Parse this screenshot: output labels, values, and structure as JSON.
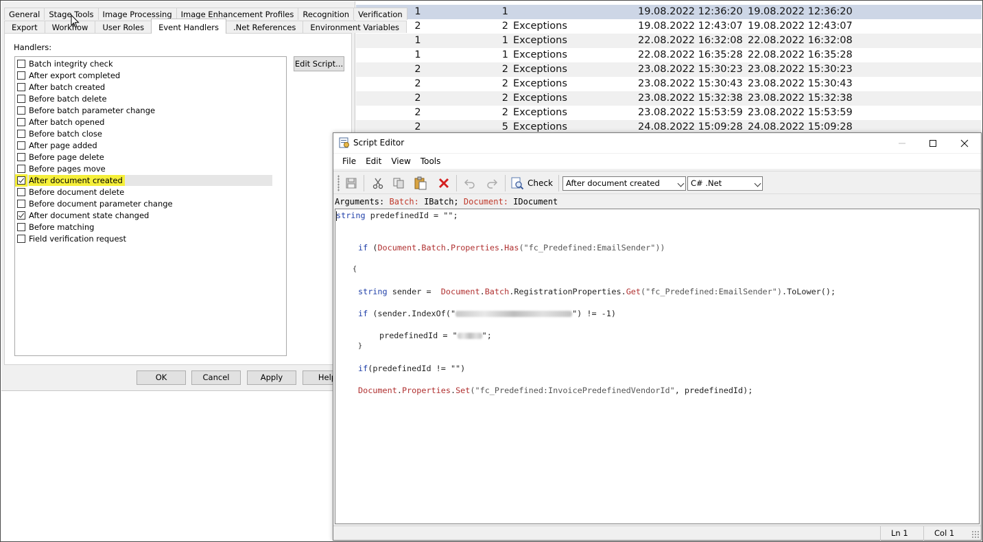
{
  "background_table": {
    "rows": [
      {
        "a": "1",
        "b": "1",
        "c": "",
        "d": "19.08.2022 12:36:20",
        "e": "19.08.2022 12:36:20"
      },
      {
        "a": "2",
        "b": "2",
        "c": "Exceptions",
        "d": "19.08.2022 12:43:07",
        "e": "19.08.2022 12:43:07"
      },
      {
        "a": "1",
        "b": "1",
        "c": "Exceptions",
        "d": "22.08.2022 16:32:08",
        "e": "22.08.2022 16:32:08"
      },
      {
        "a": "1",
        "b": "1",
        "c": "Exceptions",
        "d": "22.08.2022 16:35:28",
        "e": "22.08.2022 16:35:28"
      },
      {
        "a": "2",
        "b": "2",
        "c": "Exceptions",
        "d": "23.08.2022 15:30:23",
        "e": "23.08.2022 15:30:23"
      },
      {
        "a": "2",
        "b": "2",
        "c": "Exceptions",
        "d": "23.08.2022 15:30:43",
        "e": "23.08.2022 15:30:43"
      },
      {
        "a": "2",
        "b": "2",
        "c": "Exceptions",
        "d": "23.08.2022 15:32:38",
        "e": "23.08.2022 15:32:38"
      },
      {
        "a": "2",
        "b": "2",
        "c": "Exceptions",
        "d": "23.08.2022 15:53:59",
        "e": "23.08.2022 15:53:59"
      },
      {
        "a": "2",
        "b": "5",
        "c": "Exceptions",
        "d": "24.08.2022 15:09:28",
        "e": "24.08.2022 15:09:28"
      }
    ]
  },
  "dialog": {
    "tabs_row1": [
      "General",
      "Stage Tools",
      "Image Processing",
      "Image Enhancement Profiles",
      "Recognition",
      "Verification"
    ],
    "tabs_row2": [
      "Export",
      "Workflow",
      "User Roles",
      "Event Handlers",
      ".Net References",
      "Environment Variables"
    ],
    "active_tab": "Event Handlers",
    "handlers_label": "Handlers:",
    "edit_script_label": "Edit Script...",
    "handlers": [
      {
        "label": "Batch integrity check",
        "checked": false
      },
      {
        "label": "After export completed",
        "checked": false
      },
      {
        "label": "After batch created",
        "checked": false
      },
      {
        "label": "Before batch delete",
        "checked": false
      },
      {
        "label": "Before batch parameter change",
        "checked": false
      },
      {
        "label": "After batch opened",
        "checked": false
      },
      {
        "label": "Before batch close",
        "checked": false
      },
      {
        "label": "After page added",
        "checked": false
      },
      {
        "label": "Before page delete",
        "checked": false
      },
      {
        "label": "Before pages move",
        "checked": false
      },
      {
        "label": "After document created",
        "checked": true,
        "selected": true,
        "highlight_color": "#f5ef3a"
      },
      {
        "label": "Before document delete",
        "checked": false
      },
      {
        "label": "Before document parameter change",
        "checked": false
      },
      {
        "label": "After document state changed",
        "checked": true
      },
      {
        "label": "Before matching",
        "checked": false
      },
      {
        "label": "Field verification request",
        "checked": false
      }
    ],
    "buttons": {
      "ok": "OK",
      "cancel": "Cancel",
      "apply": "Apply",
      "help": "Help"
    }
  },
  "editor": {
    "title": "Script Editor",
    "menu": [
      "File",
      "Edit",
      "View",
      "Tools"
    ],
    "check_label": "Check",
    "event_combo": "After document created",
    "language_combo": "C# .Net",
    "arguments": {
      "prefix": "Arguments:",
      "arg1_name": "Batch:",
      "arg1_type": "IBatch;",
      "arg2_name": "Document:",
      "arg2_type": "IDocument"
    },
    "code": {
      "l1_kw": "string",
      "l1_rest": " predefinedId = \"\";",
      "l2_kw": "if",
      "l2_a": " (",
      "l2_obj": "Document",
      "l2_dot1": ".",
      "l2_batch": "Batch",
      "l2_dot2": ".",
      "l2_props": "Properties",
      "l2_dot3": ".",
      "l2_has": "Has",
      "l2_str": "(\"fc_Predefined:EmailSender\"))",
      "l3": "{",
      "l4_kw": "string",
      "l4_a": " sender =  ",
      "l4_obj": "Document",
      "l4_dot1": ".",
      "l4_batch": "Batch",
      "l4_b": ".RegistrationProperties.",
      "l4_get": "Get",
      "l4_str": "(\"fc_Predefined:EmailSender\")",
      "l4_c": ".ToLower();",
      "l5_kw": "if",
      "l5_a": " (sender.IndexOf(\"",
      "l5_b": "\") != -1)",
      "l6_a": "predefinedId = \"",
      "l6_b": "\";",
      "l7": "}",
      "l8_kw": "if",
      "l8_rest": "(predefinedId != \"\")",
      "l9_obj": "Document",
      "l9_dot1": ".",
      "l9_props": "Properties",
      "l9_dot2": ".",
      "l9_set": "Set",
      "l9_str": "(\"fc_Predefined:InvoicePredefinedVendorId\"",
      "l9_rest": ", predefinedId);"
    },
    "status": {
      "line": "Ln 1",
      "col": "Col 1"
    }
  },
  "colors": {
    "keyword_blue": "#1f3fa8",
    "member_red": "#b03030",
    "selection_row": "#cdd6e6",
    "highlight_yellow": "#f5ef3a"
  },
  "icons": [
    "save-icon",
    "cut-icon",
    "copy-icon",
    "paste-icon",
    "delete-icon",
    "undo-icon",
    "redo-icon",
    "check-icon",
    "minimize-icon",
    "maximize-icon",
    "close-icon",
    "script-editor-app-icon"
  ]
}
